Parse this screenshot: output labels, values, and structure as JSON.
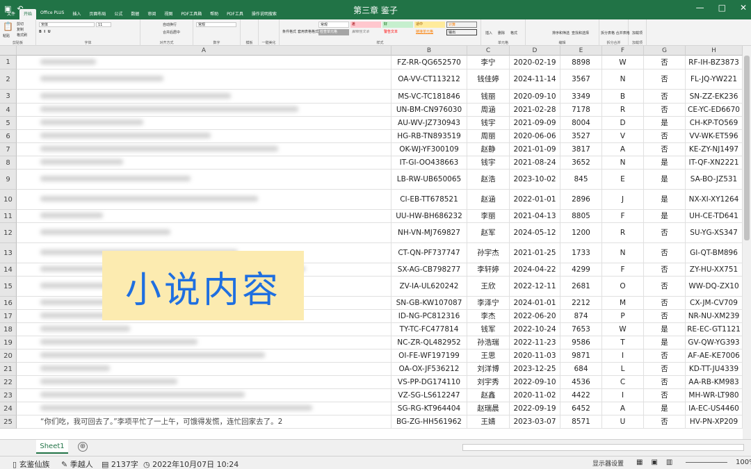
{
  "window": {
    "title": "第三章 鉴子",
    "save_icon": "save-icon",
    "undo_icon": "undo-icon",
    "minimize": "—",
    "maximize": "□",
    "close": "✕"
  },
  "ribbon_tabs": [
    "文件",
    "开始",
    "Office PLUS",
    "插入",
    "页面布局",
    "公式",
    "数据",
    "审阅",
    "视图",
    "PDF工具箱",
    "帮助",
    "PDF工具",
    "操作说明搜索"
  ],
  "ribbon": {
    "clipboard_label": "剪贴板",
    "font_label": "字体",
    "align_label": "对齐方式",
    "number_label": "数字",
    "template_label": "模板",
    "oneclick_label": "一键美化",
    "styles_label": "样式",
    "cells_label": "单元格",
    "edit_label": "编辑",
    "split_label": "拆分合并",
    "addin_label": "加载项",
    "font_name": "宋体",
    "font_size": "11",
    "number_format": "常规",
    "paste": "粘贴",
    "cut": "剪切",
    "copy": "复制",
    "format_painter": "格式刷",
    "wrap": "自动换行",
    "merge": "合并后居中",
    "conditional": "条件格式",
    "table_format": "套用表格格式",
    "style_normal": "常规",
    "style_bad": "差",
    "style_good": "好",
    "style_neutral": "适中",
    "style_calc": "计算",
    "style_check": "检查单元格",
    "style_explain": "解释性文本",
    "style_warn": "警告文本",
    "style_link": "链接单元格",
    "style_output": "输出",
    "insert": "插入",
    "delete": "删除",
    "format": "格式",
    "sort_filter": "排序和筛选",
    "find_select": "查找和选择",
    "split_merge": "拆分表格 合并表格",
    "addins": "加载项"
  },
  "columns": [
    "A",
    "B",
    "C",
    "D",
    "E",
    "F",
    "G",
    "H"
  ],
  "rows": [
    {
      "n": "1",
      "b": "FZ-RR-QG652570",
      "c": "李宁",
      "d": "2020-02-19",
      "e": "8898",
      "f": "W",
      "g": "否",
      "h": "RF-IH-BZ3873"
    },
    {
      "n": "2",
      "b": "OA-VV-CT113212",
      "c": "钱佳婷",
      "d": "2024-11-14",
      "e": "3567",
      "f": "N",
      "g": "否",
      "h": "FL-JQ-YW221"
    },
    {
      "n": "3",
      "b": "MS-VC-TC181846",
      "c": "钱丽",
      "d": "2020-09-10",
      "e": "3349",
      "f": "B",
      "g": "否",
      "h": "SN-ZZ-EK236"
    },
    {
      "n": "4",
      "b": "UN-BM-CN976030",
      "c": "周涵",
      "d": "2021-02-28",
      "e": "7178",
      "f": "R",
      "g": "否",
      "h": "CE-YC-ED6670"
    },
    {
      "n": "5",
      "b": "AU-WV-JZ730943",
      "c": "钱宇",
      "d": "2021-09-09",
      "e": "8004",
      "f": "D",
      "g": "是",
      "h": "CH-KP-TO569"
    },
    {
      "n": "6",
      "b": "HG-RB-TN893519",
      "c": "周丽",
      "d": "2020-06-06",
      "e": "3527",
      "f": "V",
      "g": "否",
      "h": "VV-WK-ET596"
    },
    {
      "n": "7",
      "b": "OK-WJ-YF300109",
      "c": "赵静",
      "d": "2021-01-09",
      "e": "3817",
      "f": "A",
      "g": "否",
      "h": "KE-ZY-NJ1497"
    },
    {
      "n": "8",
      "b": "IT-GI-OO438663",
      "c": "钱宇",
      "d": "2021-08-24",
      "e": "3652",
      "f": "N",
      "g": "是",
      "h": "IT-QF-XN2221"
    },
    {
      "n": "9",
      "b": "LB-RW-UB650065",
      "c": "赵浩",
      "d": "2023-10-02",
      "e": "845",
      "f": "E",
      "g": "是",
      "h": "SA-BO-JZ531"
    },
    {
      "n": "10",
      "b": "CI-EB-TT678521",
      "c": "赵涵",
      "d": "2022-01-01",
      "e": "2896",
      "f": "J",
      "g": "是",
      "h": "NX-XI-XY1264"
    },
    {
      "n": "11",
      "b": "UU-HW-BH686232",
      "c": "李丽",
      "d": "2021-04-13",
      "e": "8805",
      "f": "F",
      "g": "是",
      "h": "UH-CE-TD641"
    },
    {
      "n": "12",
      "b": "NH-VN-MJ769827",
      "c": "赵军",
      "d": "2024-05-12",
      "e": "1200",
      "f": "R",
      "g": "否",
      "h": "SU-YG-XS347"
    },
    {
      "n": "13",
      "b": "CT-QN-PF737747",
      "c": "孙宇杰",
      "d": "2021-01-25",
      "e": "1733",
      "f": "N",
      "g": "否",
      "h": "GI-QT-BM896"
    },
    {
      "n": "14",
      "b": "SX-AG-CB798277",
      "c": "李轩婷",
      "d": "2024-04-22",
      "e": "4299",
      "f": "F",
      "g": "否",
      "h": "ZY-HU-XX751"
    },
    {
      "n": "15",
      "b": "ZV-IA-UL620242",
      "c": "王欣",
      "d": "2022-12-11",
      "e": "2681",
      "f": "O",
      "g": "否",
      "h": "WW-DQ-ZX10"
    },
    {
      "n": "16",
      "b": "SN-GB-KW107087",
      "c": "李泽宁",
      "d": "2024-01-01",
      "e": "2212",
      "f": "M",
      "g": "否",
      "h": "CX-JM-CV709"
    },
    {
      "n": "17",
      "b": "ID-NG-PC812316",
      "c": "李杰",
      "d": "2022-06-20",
      "e": "874",
      "f": "P",
      "g": "否",
      "h": "NR-NU-XM239"
    },
    {
      "n": "18",
      "b": "TY-TC-FC477814",
      "c": "钱军",
      "d": "2022-10-24",
      "e": "7653",
      "f": "W",
      "g": "是",
      "h": "RE-EC-GT1121"
    },
    {
      "n": "19",
      "b": "NC-ZR-QL482952",
      "c": "孙浩瑞",
      "d": "2022-11-23",
      "e": "9586",
      "f": "T",
      "g": "是",
      "h": "GV-QW-YG393"
    },
    {
      "n": "20",
      "b": "OI-FE-WF197199",
      "c": "王思",
      "d": "2020-11-03",
      "e": "9871",
      "f": "I",
      "g": "否",
      "h": "AF-AE-KE7006"
    },
    {
      "n": "21",
      "b": "OA-OX-JF536212",
      "c": "刘洋博",
      "d": "2023-12-25",
      "e": "684",
      "f": "L",
      "g": "否",
      "h": "KD-TT-JU4339"
    },
    {
      "n": "22",
      "b": "VS-PP-DG174110",
      "c": "刘宇秀",
      "d": "2022-09-10",
      "e": "4536",
      "f": "C",
      "g": "否",
      "h": "AA-RB-KM983"
    },
    {
      "n": "23",
      "b": "VZ-SG-LS612247",
      "c": "赵鑫",
      "d": "2020-11-02",
      "e": "4422",
      "f": "I",
      "g": "否",
      "h": "MH-WR-LT980"
    },
    {
      "n": "24",
      "b": "SG-RG-KT964404",
      "c": "赵瑞晨",
      "d": "2022-09-19",
      "e": "6452",
      "f": "A",
      "g": "是",
      "h": "IA-EC-US4460"
    },
    {
      "n": "25",
      "b": "BG-ZG-HH561962",
      "c": "王婧",
      "d": "2023-03-07",
      "e": "8571",
      "f": "U",
      "g": "否",
      "h": "HV-PN-XP209",
      "a": "“你们吃，我可回去了。”李项平忙了一上午，可饿得发慌，连忙回家去了。2"
    }
  ],
  "overlay_text": "小说内容",
  "sheet_tab": "Sheet1",
  "add_sheet": "⊕",
  "status": {
    "book": "玄鉴仙族",
    "author": "季越人",
    "words": "2137字",
    "datetime": "2022年10月07日 10:24",
    "display_settings": "显示器设置",
    "zoom": "100%"
  },
  "colors": {
    "brand": "#217346",
    "overlay_bg": "#fcebb0",
    "overlay_text": "#1f6fe0"
  }
}
